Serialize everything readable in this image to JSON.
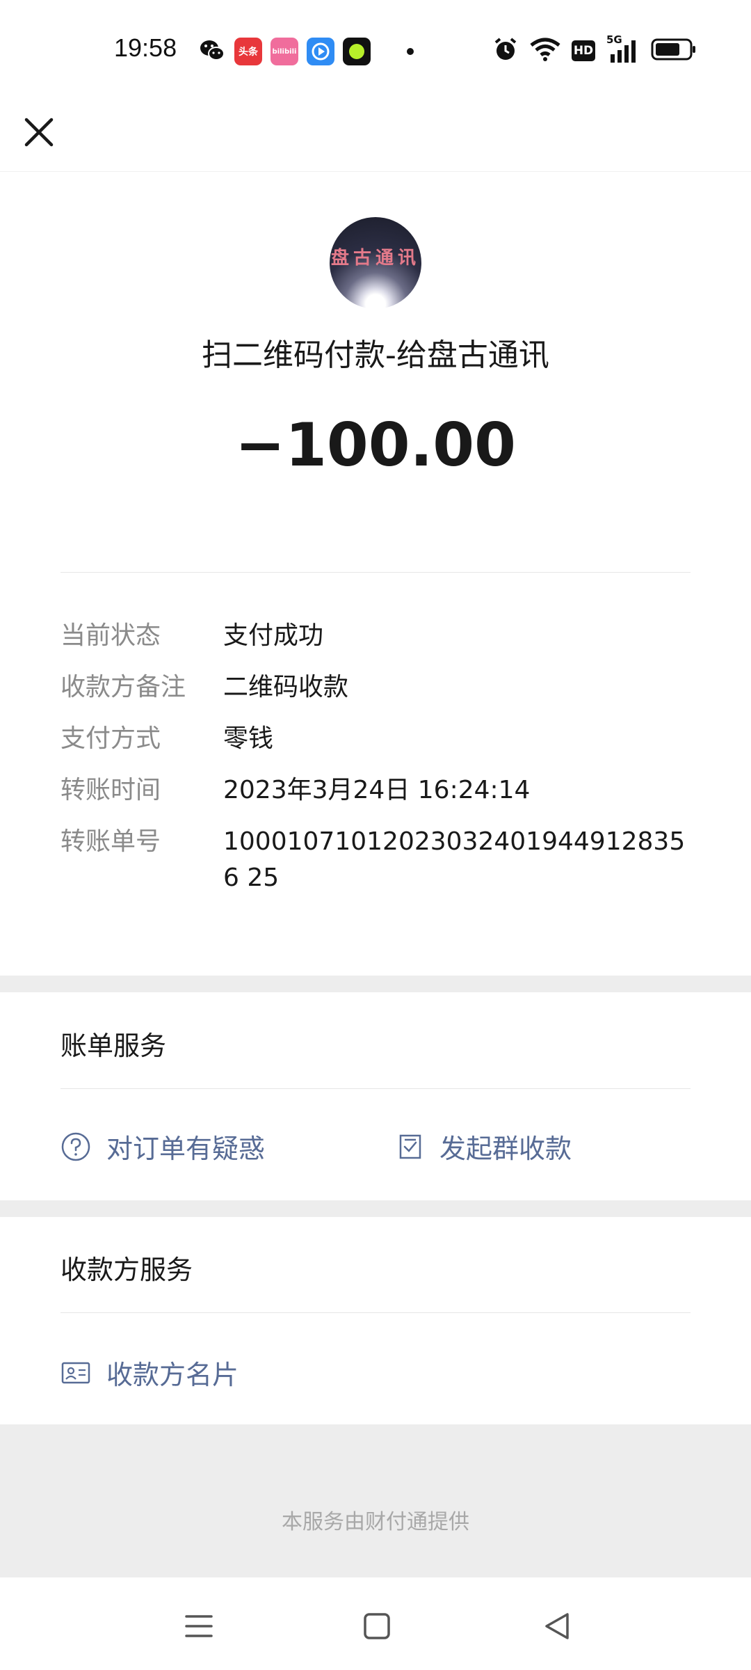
{
  "status_bar": {
    "time": "19:58",
    "notification_icons": [
      "wechat-icon",
      "toutiao-icon",
      "bilibili-icon",
      "video-player-icon",
      "green-app-icon"
    ],
    "toutiao_label": "头条",
    "bilibili_label": "bilibili",
    "system_icons": [
      "alarm-icon",
      "wifi-icon",
      "hd-icon",
      "5g-signal-icon",
      "battery-icon"
    ],
    "hd_label": "HD",
    "network_label": "5G"
  },
  "header": {
    "close_icon": "close-icon",
    "avatar_text": "盘古通讯",
    "payee_title": "扫二维码付款-给盘古通讯",
    "amount": "−100.00"
  },
  "details": [
    {
      "label": "当前状态",
      "value": "支付成功"
    },
    {
      "label": "收款方备注",
      "value": "二维码收款"
    },
    {
      "label": "支付方式",
      "value": "零钱"
    },
    {
      "label": "转账时间",
      "value": "2023年3月24日 16:24:14"
    },
    {
      "label": "转账单号",
      "value": "100010710120230324019449128356 25"
    }
  ],
  "bill_service": {
    "title": "账单服务",
    "actions": [
      {
        "label": "对订单有疑惑",
        "icon": "question-circle-icon"
      },
      {
        "label": "发起群收款",
        "icon": "group-receipt-icon"
      }
    ]
  },
  "payee_service": {
    "title": "收款方服务",
    "actions": [
      {
        "label": "收款方名片",
        "icon": "contact-card-icon"
      }
    ]
  },
  "footer": {
    "text": "本服务由财付通提供"
  },
  "nav_bar": {
    "buttons": [
      "menu-icon",
      "home-square-icon",
      "back-triangle-icon"
    ]
  },
  "colors": {
    "link": "#576b95",
    "label_gray": "#8a8a8a",
    "background_gray": "#ededed"
  }
}
